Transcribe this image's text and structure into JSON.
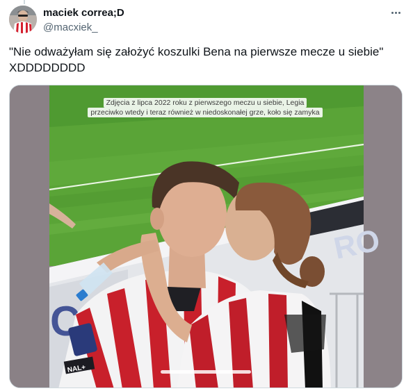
{
  "tweet": {
    "author": {
      "display_name": "maciek correa;D",
      "handle": "@macxiek_"
    },
    "menu_icon": "more-horizontal-icon",
    "text": "\"Nie odważyłam się założyć koszulki Bena na pierwsze mecze u siebie\"\nXDDDDDDDD",
    "media": {
      "caption": "Zdjęcia z lipca 2022 roku z pierwszego meczu u siebie, Legia przeciwko wtedy i teraz również w niedoskonałej grze, koło się zamyka"
    }
  }
}
